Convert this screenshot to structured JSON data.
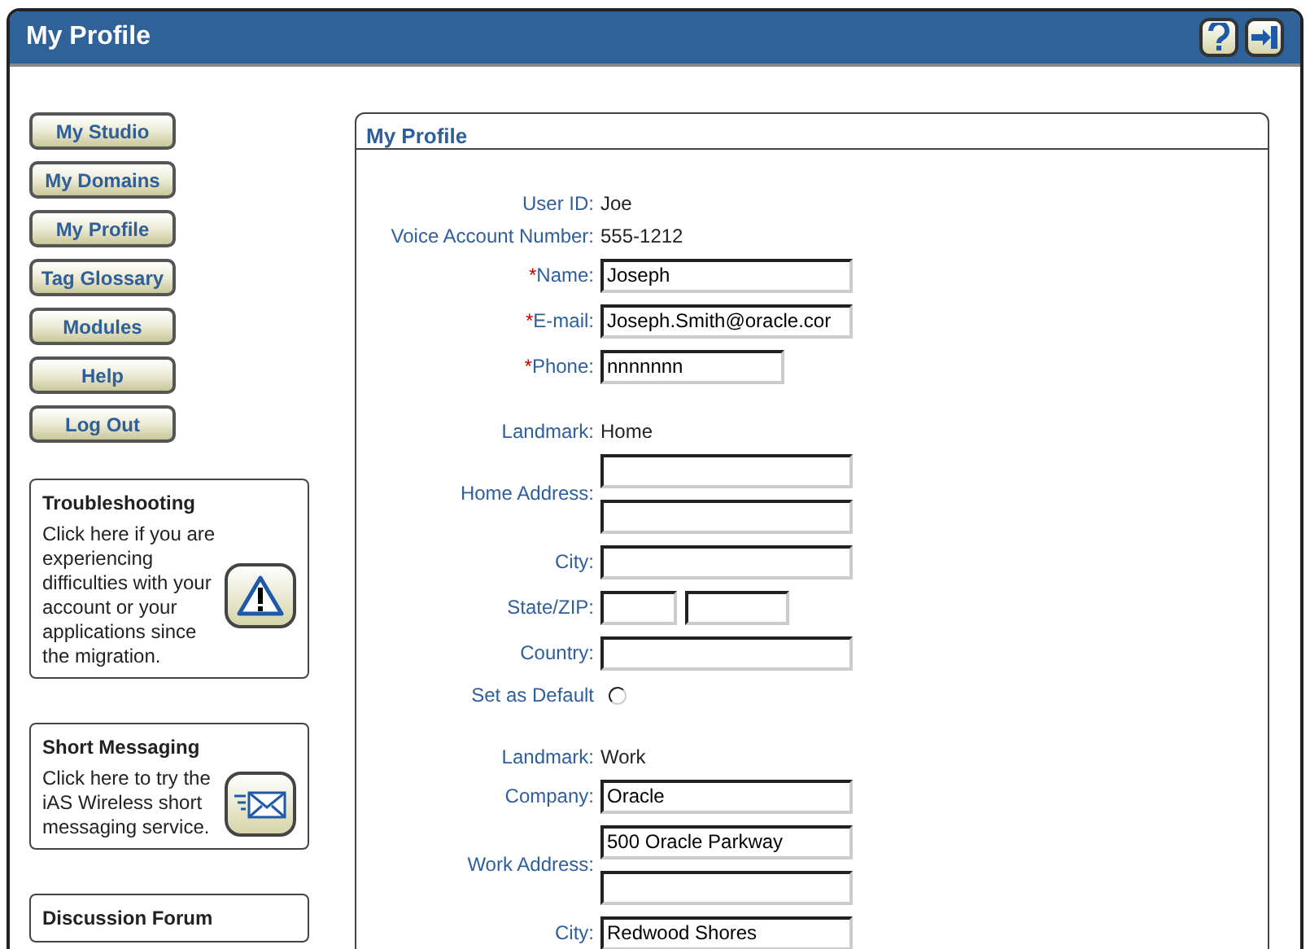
{
  "window": {
    "title": "My Profile"
  },
  "nav_buttons": [
    "My Studio",
    "My Domains",
    "My Profile",
    "Tag Glossary",
    "Modules",
    "Help",
    "Log Out"
  ],
  "info_boxes": [
    {
      "kind": "warning",
      "title": "Troubleshooting",
      "text": "Click here if you are experiencing difficulties with your account or your applications since the migration."
    },
    {
      "kind": "mail",
      "title": "Short Messaging",
      "text": "Click here to try the iAS Wireless short messaging service."
    },
    {
      "title": "Discussion Forum"
    }
  ],
  "panel": {
    "title": "My Profile",
    "rows": [
      {
        "kind": "text",
        "label": "User ID:",
        "value": "Joe"
      },
      {
        "kind": "text",
        "label": "Voice Account Number:",
        "value": "555-1212"
      },
      {
        "kind": "input",
        "required_mark": "*",
        "label": "Name:",
        "value": "Joseph"
      },
      {
        "kind": "input",
        "required_mark": "*",
        "label": "E-mail:",
        "value": "Joseph.Smith@oracle.cor"
      },
      {
        "kind": "short_input",
        "required_mark": "*",
        "label": "Phone:",
        "value": "nnnnnnn"
      },
      {
        "kind": "gap"
      },
      {
        "kind": "text",
        "label": "Landmark:",
        "value": "Home"
      },
      {
        "kind": "address",
        "label": "Home Address:"
      },
      {
        "kind": "input",
        "label": "City:"
      },
      {
        "kind": "state_zip",
        "label": "State/ZIP:"
      },
      {
        "kind": "input",
        "label": "Country:"
      },
      {
        "kind": "radio",
        "label": "Set as Default",
        "checked": false
      },
      {
        "kind": "gap"
      },
      {
        "kind": "text",
        "label": "Landmark:",
        "value": "Work"
      },
      {
        "kind": "input",
        "label": "Company:",
        "value": "Oracle"
      },
      {
        "kind": "address",
        "label": "Work Address:",
        "line_1": "500 Oracle Parkway"
      },
      {
        "kind": "input",
        "label": "City:",
        "value": "Redwood Shores"
      }
    ]
  }
}
